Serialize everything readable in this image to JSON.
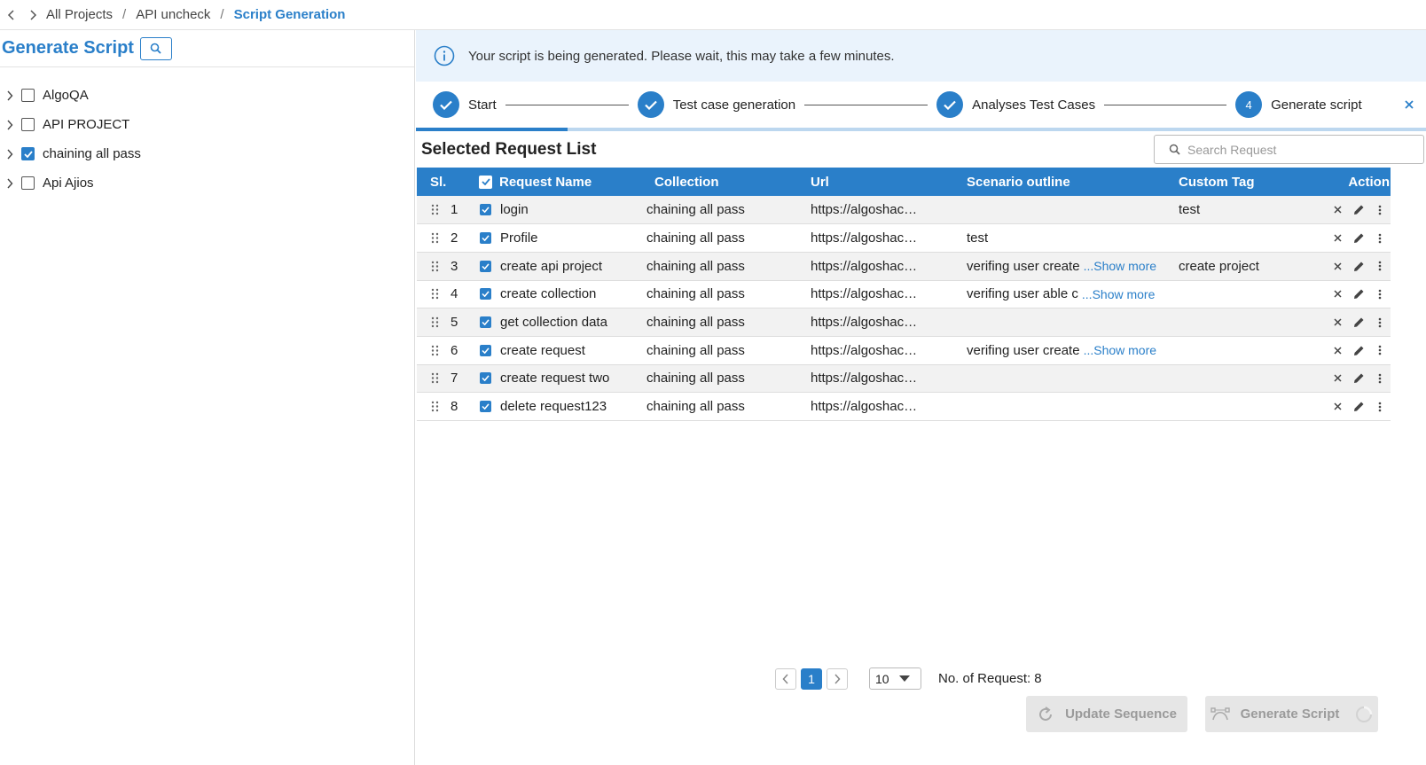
{
  "breadcrumb": {
    "items": [
      "All Projects",
      "API uncheck"
    ],
    "current": "Script Generation"
  },
  "left_panel": {
    "title": "Generate Script",
    "tree": [
      {
        "label": "AlgoQA",
        "checked": false
      },
      {
        "label": "API PROJECT",
        "checked": false
      },
      {
        "label": "chaining all pass",
        "checked": true
      },
      {
        "label": "Api Ajios",
        "checked": false
      }
    ]
  },
  "banner": {
    "message": "Your script is being generated. Please wait, this may take a few minutes."
  },
  "stepper": {
    "steps": [
      {
        "label": "Start",
        "status": "done"
      },
      {
        "label": "Test case generation",
        "status": "done"
      },
      {
        "label": "Analyses Test Cases",
        "status": "done"
      },
      {
        "label": "Generate script",
        "status": "active",
        "number": "4"
      }
    ],
    "progress_fraction": 0.15
  },
  "request_list": {
    "title": "Selected Request List",
    "search_placeholder": "Search Request",
    "columns": {
      "sl": "Sl.",
      "request_name": "Request Name",
      "collection": "Collection",
      "url": "Url",
      "scenario": "Scenario outline",
      "tag": "Custom Tag",
      "action": "Action"
    },
    "show_more_label": "...Show more",
    "rows": [
      {
        "sl": "1",
        "name": "login",
        "collection": "chaining all pass",
        "url": "https://algoshac…",
        "scenario": "",
        "show_more": false,
        "tag": "test"
      },
      {
        "sl": "2",
        "name": "Profile",
        "collection": "chaining all pass",
        "url": "https://algoshac…",
        "scenario": "test",
        "show_more": false,
        "tag": ""
      },
      {
        "sl": "3",
        "name": "create api project",
        "collection": "chaining all pass",
        "url": "https://algoshac…",
        "scenario": "verifing user create",
        "show_more": true,
        "tag": "create project"
      },
      {
        "sl": "4",
        "name": "create collection",
        "collection": "chaining all pass",
        "url": "https://algoshac…",
        "scenario": "verifing user able c",
        "show_more": true,
        "tag": ""
      },
      {
        "sl": "5",
        "name": "get collection data",
        "collection": "chaining all pass",
        "url": "https://algoshac…",
        "scenario": "",
        "show_more": false,
        "tag": ""
      },
      {
        "sl": "6",
        "name": "create request",
        "collection": "chaining all pass",
        "url": "https://algoshac…",
        "scenario": "verifing user create",
        "show_more": true,
        "tag": ""
      },
      {
        "sl": "7",
        "name": "create request two",
        "collection": "chaining all pass",
        "url": "https://algoshac…",
        "scenario": "",
        "show_more": false,
        "tag": ""
      },
      {
        "sl": "8",
        "name": "delete request123",
        "collection": "chaining all pass",
        "url": "https://algoshac…",
        "scenario": "",
        "show_more": false,
        "tag": ""
      }
    ]
  },
  "pagination": {
    "current_page": "1",
    "page_size": "10",
    "count_label": "No. of Request:",
    "count_value": "8"
  },
  "buttons": {
    "update_sequence": "Update Sequence",
    "generate_script": "Generate Script"
  },
  "colors": {
    "accent": "#2a7fc9",
    "banner_bg": "#eaf3fc",
    "disabled_bg": "#e6e6e6"
  }
}
